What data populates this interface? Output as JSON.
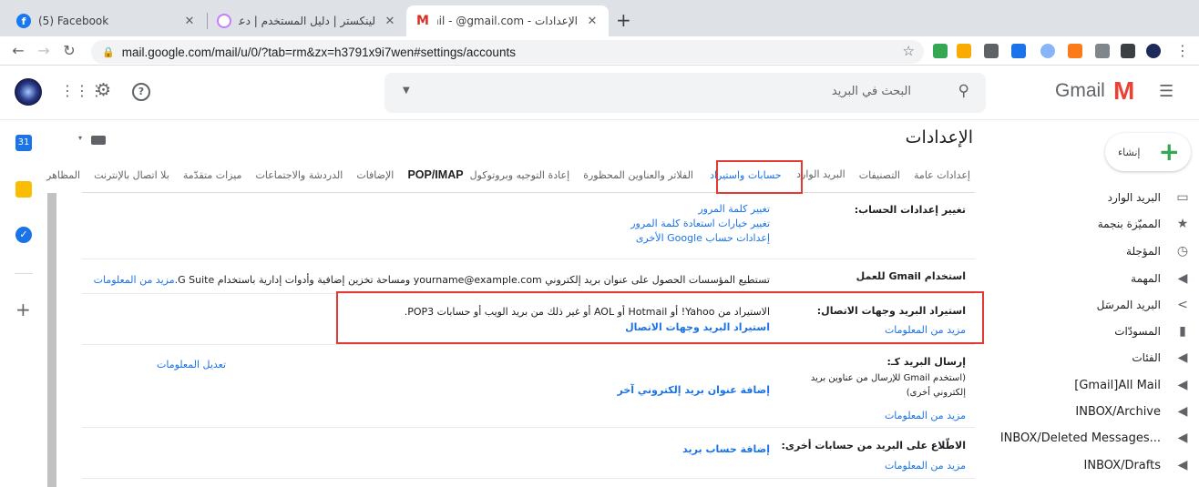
{
  "browser": {
    "tabs": [
      {
        "title": "(5) Facebook"
      },
      {
        "title": "لينكستر | دليل المستخدم | دعم العم"
      },
      {
        "title": "الإعدادات - Gmail - @gmail.com"
      }
    ],
    "url": "mail.google.com/mail/u/0/?tab=rm&zx=h3791x9i7wen#settings/accounts"
  },
  "gmail": {
    "logo_text": "Gmail",
    "search_placeholder": "البحث في البريد",
    "compose_label": "إنشاء",
    "nav": [
      {
        "label": "البريد الوارد",
        "icon": "inbox-icon"
      },
      {
        "label": "المميّزة بنجمة",
        "icon": "star-icon"
      },
      {
        "label": "المؤجلة",
        "icon": "clock-icon"
      },
      {
        "label": "المهمة",
        "icon": "important-icon"
      },
      {
        "label": "البريد المرسَل",
        "icon": "send-icon"
      },
      {
        "label": "المسودّات",
        "icon": "draft-icon"
      },
      {
        "label": "الفئات",
        "icon": "label-icon"
      },
      {
        "label": "[Gmail]All Mail",
        "icon": "label-icon"
      },
      {
        "label": "INBOX/Archive",
        "icon": "label-icon"
      },
      {
        "label": "INBOX/Deleted Messages...",
        "icon": "label-icon"
      },
      {
        "label": "INBOX/Drafts",
        "icon": "label-icon"
      }
    ]
  },
  "settings": {
    "title": "الإعدادات",
    "tabs": [
      "إعدادات عامة",
      "التصنيفات",
      "البريد الوارد",
      "حسابات واستيراد",
      "الفلاتر والعناوين المحظورة",
      "إعادة التوجيه وبروتوكول",
      "POP/IMAP",
      "الإضافات",
      "الدردشة والاجتماعات",
      "ميزات متقدّمة",
      "بلا اتصال بالإنترنت",
      "المظاهر"
    ],
    "change_account": {
      "label": "تغيير إعدادات الحساب:",
      "links": [
        "تغيير كلمة المرور",
        "تغيير خيارات استعادة كلمة المرور",
        "إعدادات حساب Google الأخرى"
      ]
    },
    "business": {
      "label": "استخدام Gmail للعمل",
      "text": "تستطيع المؤسسات الحصول على عنوان بريد إلكتروني yourname@example.com ومساحة تخزين إضافية وأدوات إدارية باستخدام G Suite.",
      "more": "مزيد من المعلومات"
    },
    "import": {
      "label": "استيراد البريد وجهات الاتصال:",
      "more": "مزيد من المعلومات",
      "text": "الاستيراد من Yahoo! أو Hotmail أو AOL أو غير ذلك من بريد الويب أو حسابات POP3.",
      "action": "استيراد البريد وجهات الاتصال"
    },
    "send_as": {
      "label": "إرسال البريد كـ:",
      "note": "(استخدم Gmail للإرسال من عناوين بريد إلكتروني أخرى)",
      "more": "مزيد من المعلومات",
      "action": "إضافة عنوان بريد إلكتروني آخر",
      "edit": "تعديل المعلومات"
    },
    "check_mail": {
      "label": "الاطّلاع على البريد من حسابات أخرى:",
      "more": "مزيد من المعلومات",
      "action": "إضافة حساب بريد"
    }
  },
  "colors": {
    "accent": "#1a73e8",
    "highlight": "#e53935"
  }
}
